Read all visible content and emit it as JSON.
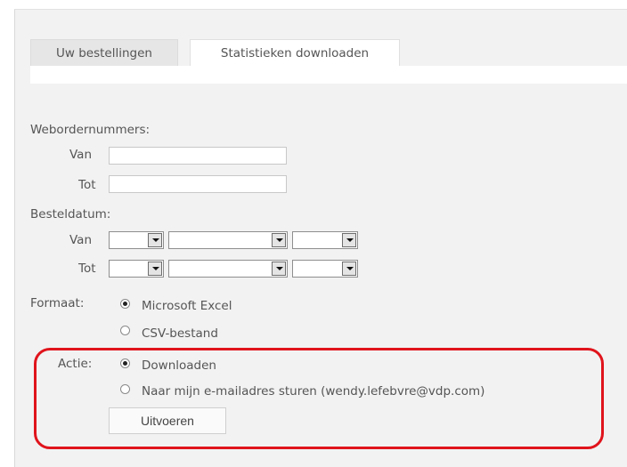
{
  "tabs": [
    {
      "label": "Uw bestellingen",
      "active": false
    },
    {
      "label": "Statistieken downloaden",
      "active": true
    }
  ],
  "form": {
    "webordernummers": {
      "heading": "Webordernummers:",
      "van_label": "Van",
      "tot_label": "Tot",
      "van_value": "",
      "tot_value": ""
    },
    "besteldatum": {
      "heading": "Besteldatum:",
      "van_label": "Van",
      "tot_label": "Tot",
      "van_day": "",
      "van_month": "",
      "van_year": "",
      "tot_day": "",
      "tot_month": "",
      "tot_year": ""
    },
    "formaat": {
      "label": "Formaat:",
      "options": [
        "Microsoft Excel",
        "CSV-bestand"
      ],
      "selected": "Microsoft Excel"
    },
    "actie": {
      "label": "Actie:",
      "options": [
        "Downloaden",
        "Naar mijn e-mailadres sturen (wendy.lefebvre@vdp.com)"
      ],
      "selected": "Downloaden"
    },
    "submit_label": "Uitvoeren"
  },
  "colors": {
    "highlight_border": "#e0141c",
    "panel_background": "#f2f2f2"
  },
  "icons": {
    "dropdown": "dropdown-arrow-icon",
    "radio": "radio-button"
  }
}
